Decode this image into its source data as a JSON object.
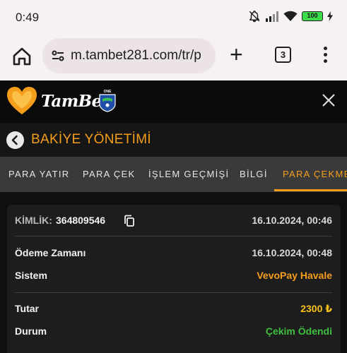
{
  "status_bar": {
    "time": "0:49",
    "battery": "100"
  },
  "browser": {
    "url": "m.tambet281.com/tr/p",
    "tab_count": "3"
  },
  "site": {
    "logo_text": "TamBet",
    "badge": "ONE"
  },
  "page": {
    "title": "BAKİYE YÖNETİMİ"
  },
  "tabs": [
    {
      "label": "PARA YATIR"
    },
    {
      "label": "PARA ÇEK"
    },
    {
      "label": "İŞLEM GEÇMİŞİ"
    },
    {
      "label": "BİLGİ"
    },
    {
      "label": "PARA ÇEKME"
    }
  ],
  "transaction": {
    "id_label": "KİMLİK:",
    "id_value": "364809546",
    "created_at": "16.10.2024, 00:46",
    "payment_time_label": "Ödeme Zamanı",
    "payment_time_value": "16.10.2024, 00:48",
    "system_label": "Sistem",
    "system_value": "VevoPay Havale",
    "amount_label": "Tutar",
    "amount_value": "2300 ₺",
    "status_label": "Durum",
    "status_value": "Çekim Ödendi"
  },
  "colors": {
    "accent": "#f59e1b",
    "success": "#3fbf3f",
    "amount": "#f7c21a"
  }
}
